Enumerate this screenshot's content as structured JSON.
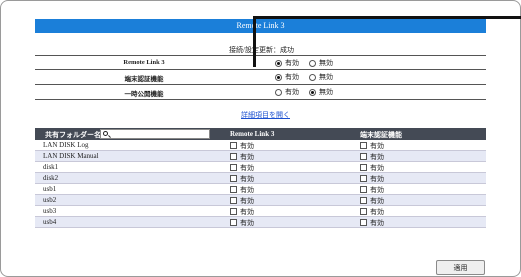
{
  "header": {
    "title": "Remote Link 3"
  },
  "status": "接続/設定更新：成功",
  "settings": [
    {
      "label": "Remote Link 3",
      "options": [
        "有効",
        "無効"
      ],
      "selected": 0
    },
    {
      "label": "端末認証機能",
      "options": [
        "有効",
        "無効"
      ],
      "selected": 0
    },
    {
      "label": "一時公開機能",
      "options": [
        "有効",
        "無効"
      ],
      "selected": 1
    }
  ],
  "detail_link": "詳細項目を開く",
  "share_table": {
    "columns": [
      "共有フォルダー名",
      "Remote Link 3",
      "端末認証機能"
    ],
    "search_placeholder": "",
    "rows": [
      {
        "name": "LAN DISK Log",
        "c1": "有効",
        "c2": "有効"
      },
      {
        "name": "LAN DISK Manual",
        "c1": "有効",
        "c2": "有効"
      },
      {
        "name": "disk1",
        "c1": "有効",
        "c2": "有効"
      },
      {
        "name": "disk2",
        "c1": "有効",
        "c2": "有効"
      },
      {
        "name": "usb1",
        "c1": "有効",
        "c2": "有効"
      },
      {
        "name": "usb2",
        "c1": "有効",
        "c2": "有効"
      },
      {
        "name": "usb3",
        "c1": "有効",
        "c2": "有効"
      },
      {
        "name": "usb4",
        "c1": "有効",
        "c2": "有効"
      }
    ]
  },
  "apply_button": "適用",
  "colors": {
    "header": "#1b7fd9",
    "table_head": "#444a55",
    "row_alt": "#e6e9f5",
    "link": "#1a4fd0"
  }
}
